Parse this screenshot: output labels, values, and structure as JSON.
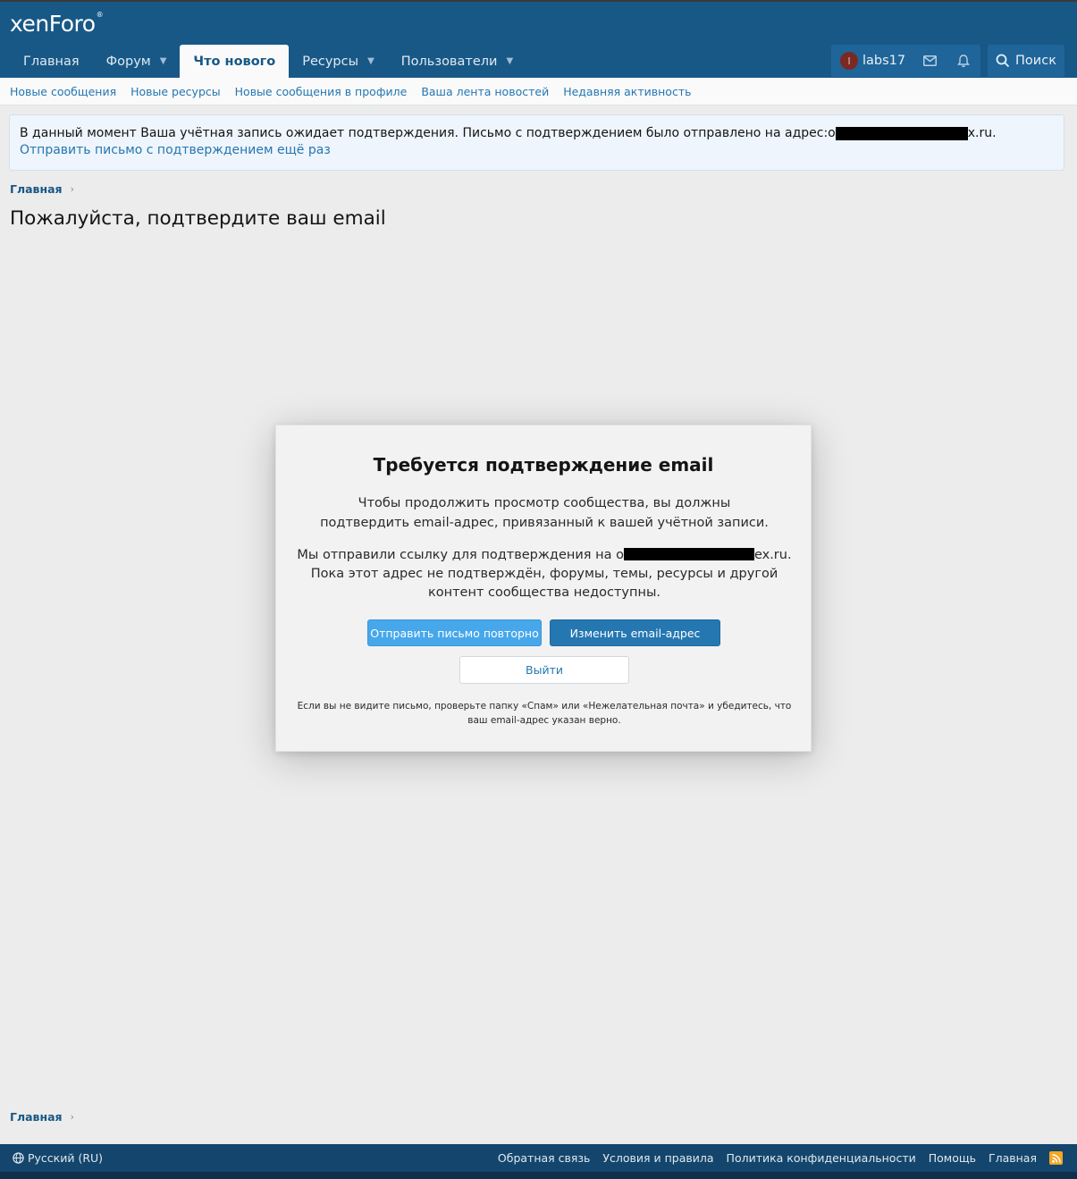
{
  "header": {
    "logo_text": "xenForo",
    "logo_mark": "®",
    "nav": [
      {
        "label": "Главная"
      },
      {
        "label": "Форум"
      },
      {
        "label": "Что нового"
      },
      {
        "label": "Ресурсы"
      },
      {
        "label": "Пользователи"
      }
    ],
    "user": {
      "initial": "l",
      "name": "labs17"
    },
    "search_label": "Поиск"
  },
  "subnav": [
    "Новые сообщения",
    "Новые ресурсы",
    "Новые сообщения в профиле",
    "Ваша лента новостей",
    "Недавняя активность"
  ],
  "notice": {
    "text": "В данный момент Ваша учётная запись ожидает подтверждения. Письмо с подтверждением было отправлено на адрес: ",
    "email_start": "o",
    "email_end": "x.ru.",
    "resend_link": "Отправить письмо с подтверждением ещё раз"
  },
  "breadcrumb": {
    "label": "Главная"
  },
  "page_title": "Пожалуйста, подтвердите ваш email",
  "modal": {
    "title": "Требуется подтверждение email",
    "p1": "Чтобы продолжить просмотр сообщества, вы должны подтвердить email-адрес, привязанный к вашей учётной записи.",
    "p2_start": "Мы отправили ссылку для подтверждения на o",
    "p2_end": "ex.ru. Пока этот адрес не подтверждён, форумы, темы, ресурсы и другой контент сообщества недоступны.",
    "resend_button": "Отправить письмо повторно",
    "change_button": "Изменить email-адрес",
    "logout_button": "Выйти",
    "hint": "Если вы не видите письмо, проверьте папку «Спам» или «Нежелательная почта» и убедитесь, что ваш email-адрес указан верно."
  },
  "footer": {
    "language": "Русский (RU)",
    "links": [
      "Обратная связь",
      "Условия и правила",
      "Политика конфиденциальности",
      "Помощь",
      "Главная"
    ]
  },
  "colors": {
    "header": "#185886",
    "link": "#2577b1",
    "footer": "#14466d",
    "accent_button": "#47a7eb"
  }
}
